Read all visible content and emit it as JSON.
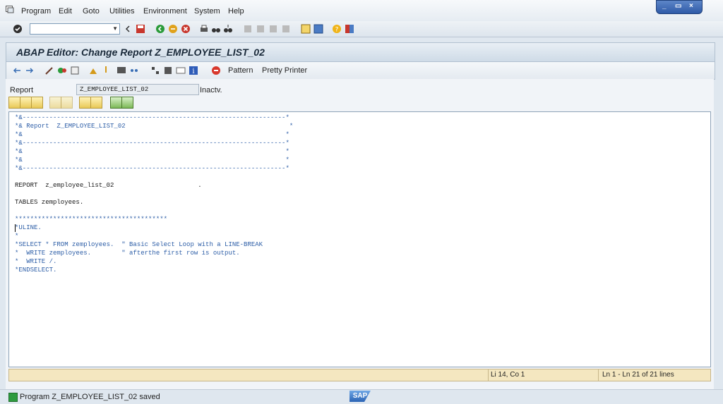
{
  "menu": {
    "items": [
      "Program",
      "Edit",
      "Goto",
      "Utilities",
      "Environment",
      "System",
      "Help"
    ]
  },
  "window": {
    "minimize": "_",
    "restore": "▭",
    "close": "×"
  },
  "title": "ABAP Editor: Change Report Z_EMPLOYEE_LIST_02",
  "app_toolbar": {
    "pattern_label": "Pattern",
    "pretty_label": "Pretty Printer"
  },
  "report": {
    "label": "Report",
    "value": "Z_EMPLOYEE_LIST_02",
    "status": "Inactv."
  },
  "code": [
    "*&---------------------------------------------------------------------*",
    "*& Report  Z_EMPLOYEE_LIST_02                                           *",
    "*&                                                                     *",
    "*&---------------------------------------------------------------------*",
    "*&                                                                     *",
    "*&                                                                     *",
    "*&---------------------------------------------------------------------*",
    "",
    "REPORT  z_employee_list_02                      .",
    "",
    "TABLES zemployees.",
    "",
    "****************************************",
    "*ULINE.",
    "*",
    "*SELECT * FROM zemployees.  \" Basic Select Loop with a LINE-BREAK",
    "*  WRITE zemployees.        \" afterthe first row is output.",
    "*  WRITE /.",
    "*ENDSELECT."
  ],
  "editor_status": {
    "position": "Li 14, Co 1",
    "lines": "Ln 1 - Ln 21 of 21 lines"
  },
  "status": {
    "message": "Program Z_EMPLOYEE_LIST_02 saved",
    "logo": "SAP"
  },
  "colors": {
    "code_comment": "#2d5ea7",
    "code_plain": "#1a1a1a",
    "status_bar": "#f4e7c0"
  }
}
